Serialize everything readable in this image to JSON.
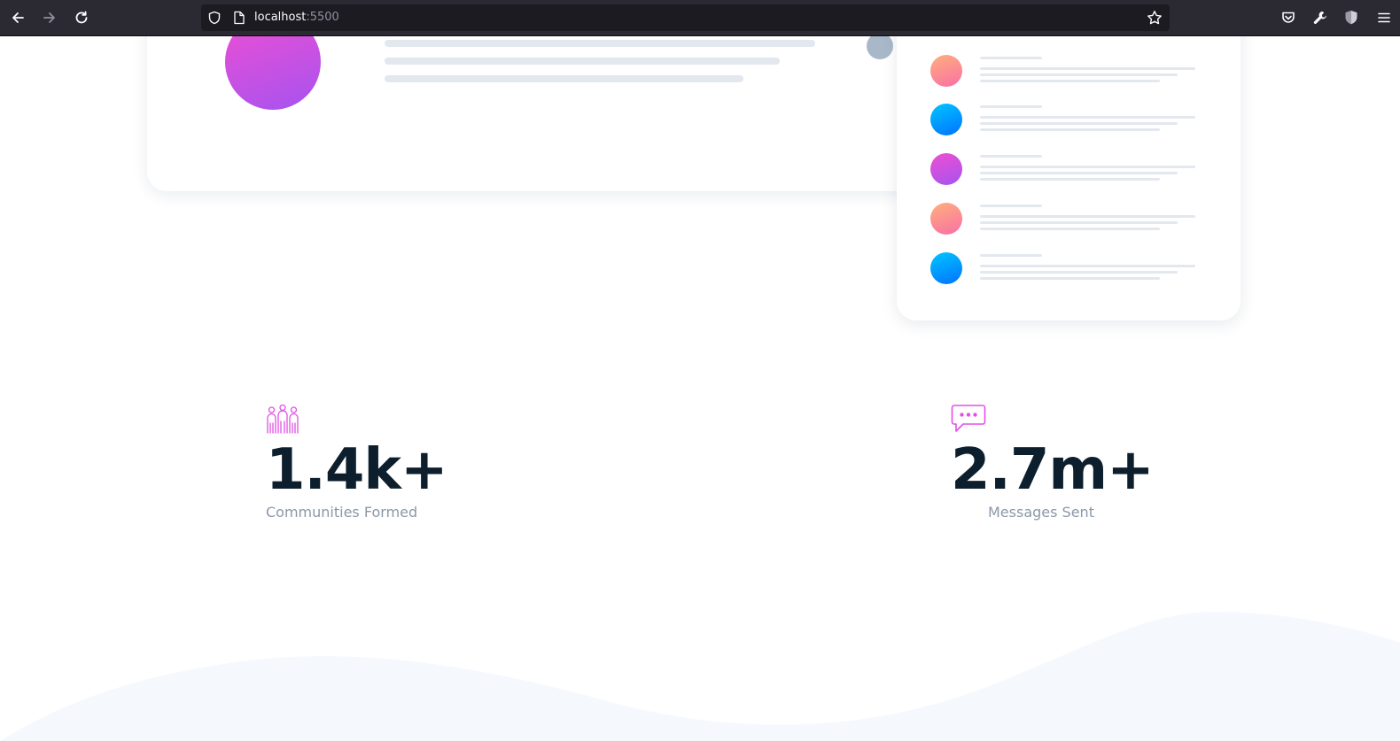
{
  "browser": {
    "url_host": "localhost",
    "url_port": ":5500",
    "icons": {
      "back": "arrow-left-icon",
      "forward": "arrow-right-icon",
      "reload": "reload-icon",
      "tracking": "shield-icon",
      "page": "page-icon",
      "bookmark": "star-icon",
      "pocket": "pocket-icon",
      "devtools": "wrench-icon",
      "extension": "shield-extension-icon",
      "menu": "hamburger-menu-icon"
    }
  },
  "stats": [
    {
      "icon": "communities-icon",
      "value": "1.4k+",
      "label": "Communities Formed"
    },
    {
      "icon": "chat-bubble-icon",
      "value": "2.7m+",
      "label": "Messages Sent"
    }
  ],
  "colors": {
    "accent": "#e251e4",
    "stat_value": "#0d1e2d",
    "stat_label": "#8b98a8",
    "wave": "#f5f9fd",
    "toolbar": "#2b2a33"
  }
}
